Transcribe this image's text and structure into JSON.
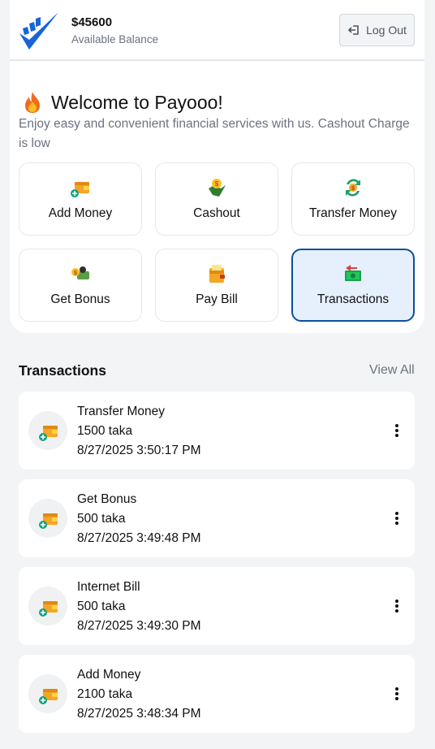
{
  "header": {
    "balance_amount": "$45600",
    "balance_label": "Available Balance",
    "logout_label": "Log Out"
  },
  "welcome": {
    "title": "Welcome to Payooo!",
    "subtitle": "Enjoy easy and convenient financial services with us. Cashout Charge is low"
  },
  "actions": [
    {
      "label": "Add Money",
      "icon": "wallet-add-icon"
    },
    {
      "label": "Cashout",
      "icon": "cashout-coin-icon"
    },
    {
      "label": "Transfer Money",
      "icon": "transfer-coin-icon"
    },
    {
      "label": "Get Bonus",
      "icon": "bonus-icon"
    },
    {
      "label": "Pay Bill",
      "icon": "bill-wallet-icon"
    },
    {
      "label": "Transactions",
      "icon": "transactions-cash-icon",
      "active": true
    }
  ],
  "transactions": {
    "heading": "Transactions",
    "view_all": "View All",
    "items": [
      {
        "title": "Transfer Money",
        "amount": "1500 taka",
        "time": "8/27/2025 3:50:17 PM"
      },
      {
        "title": "Get Bonus",
        "amount": "500 taka",
        "time": "8/27/2025 3:49:48 PM"
      },
      {
        "title": "Internet Bill",
        "amount": "500 taka",
        "time": "8/27/2025 3:49:30 PM"
      },
      {
        "title": "Add Money",
        "amount": "2100 taka",
        "time": "8/27/2025 3:48:34 PM"
      }
    ]
  },
  "colors": {
    "brand_blue": "#1565d8",
    "active_border": "#0b4f9c",
    "active_bg": "#e6f0fd",
    "wallet_orange": "#f5a623"
  }
}
